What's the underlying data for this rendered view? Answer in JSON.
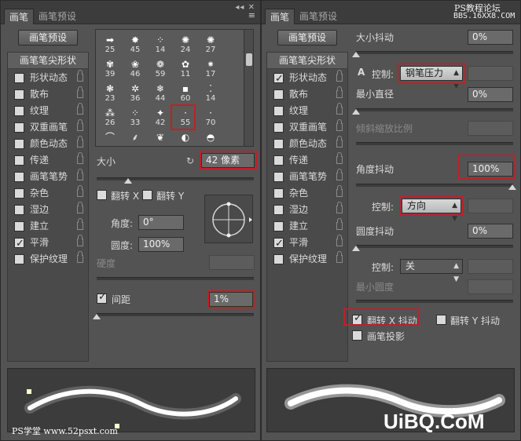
{
  "left": {
    "tabs": [
      "画笔",
      "画笔预设"
    ],
    "panel_controls": "◂◂ ✕",
    "menu_icon": "≡",
    "preset_button": "画笔预设",
    "list_header": "画笔笔尖形状",
    "list_items": [
      {
        "label": "形状动态",
        "checked": false
      },
      {
        "label": "散布",
        "checked": false
      },
      {
        "label": "纹理",
        "checked": false
      },
      {
        "label": "双重画笔",
        "checked": false
      },
      {
        "label": "颜色动态",
        "checked": false
      },
      {
        "label": "传递",
        "checked": false
      },
      {
        "label": "画笔笔势",
        "checked": false
      },
      {
        "label": "杂色",
        "checked": false
      },
      {
        "label": "湿边",
        "checked": false
      },
      {
        "label": "建立",
        "checked": false
      },
      {
        "label": "平滑",
        "checked": true
      },
      {
        "label": "保护纹理",
        "checked": false
      }
    ],
    "brush_grid": [
      {
        "num": "25",
        "sym": "➡"
      },
      {
        "num": "45",
        "sym": "✸"
      },
      {
        "num": "14",
        "sym": "⁘"
      },
      {
        "num": "24",
        "sym": "✺"
      },
      {
        "num": "27",
        "sym": "✺"
      },
      {
        "num": "",
        "sym": ""
      },
      {
        "num": "39",
        "sym": "✾"
      },
      {
        "num": "46",
        "sym": "❀"
      },
      {
        "num": "59",
        "sym": "❁"
      },
      {
        "num": "11",
        "sym": "✿"
      },
      {
        "num": "17",
        "sym": "⁕"
      },
      {
        "num": "",
        "sym": ""
      },
      {
        "num": "23",
        "sym": "❃"
      },
      {
        "num": "36",
        "sym": "✲"
      },
      {
        "num": "44",
        "sym": "❄"
      },
      {
        "num": "60",
        "sym": "▪"
      },
      {
        "num": "14",
        "sym": "⁚"
      },
      {
        "num": "",
        "sym": ""
      },
      {
        "num": "26",
        "sym": "⁂"
      },
      {
        "num": "33",
        "sym": "⁘"
      },
      {
        "num": "42",
        "sym": "✦"
      },
      {
        "num": "55",
        "sym": "·"
      },
      {
        "num": "70",
        "sym": "·"
      },
      {
        "num": "",
        "sym": ""
      },
      {
        "num": "",
        "sym": "⌒"
      },
      {
        "num": "",
        "sym": "⸙"
      },
      {
        "num": "",
        "sym": "❦"
      },
      {
        "num": "",
        "sym": "◐"
      },
      {
        "num": "",
        "sym": "◓"
      },
      {
        "num": "",
        "sym": ""
      }
    ],
    "size_label": "大小",
    "size_value": "42 像素",
    "reset_icon": "↻",
    "flip_x": "翻转 X",
    "flip_y": "翻转 Y",
    "angle_label": "角度:",
    "angle_value": "0°",
    "roundness_label": "圆度:",
    "roundness_value": "100%",
    "hardness_label": "硬度",
    "spacing_label": "间距",
    "spacing_value": "1%",
    "spacing_checked": true,
    "watermark_bottom": "PS学堂 www.52psxt.com"
  },
  "right": {
    "tabs": [
      "画笔",
      "画笔预设"
    ],
    "watermark_top1": "PS教程论坛",
    "watermark_top2": "BBS.16XX8.COM",
    "preset_button": "画笔预设",
    "list_header": "画笔笔尖形状",
    "list_items": [
      {
        "label": "形状动态",
        "checked": true
      },
      {
        "label": "散布",
        "checked": false
      },
      {
        "label": "纹理",
        "checked": false
      },
      {
        "label": "双重画笔",
        "checked": false
      },
      {
        "label": "颜色动态",
        "checked": false
      },
      {
        "label": "传递",
        "checked": false
      },
      {
        "label": "画笔笔势",
        "checked": false
      },
      {
        "label": "杂色",
        "checked": false
      },
      {
        "label": "湿边",
        "checked": false
      },
      {
        "label": "建立",
        "checked": false
      },
      {
        "label": "平滑",
        "checked": true
      },
      {
        "label": "保护纹理",
        "checked": false
      }
    ],
    "size_jitter_label": "大小抖动",
    "size_jitter_value": "0%",
    "warning_icon": "A",
    "control_label": "控制:",
    "control1_value": "钢笔压力",
    "min_diameter_label": "最小直径",
    "min_diameter_value": "0%",
    "tilt_scale_label": "倾斜缩放比例",
    "angle_jitter_label": "角度抖动",
    "angle_jitter_value": "100%",
    "control2_value": "方向",
    "roundness_jitter_label": "圆度抖动",
    "roundness_jitter_value": "0%",
    "control3_value": "关",
    "min_roundness_label": "最小圆度",
    "flip_x_jitter": "翻转 X 抖动",
    "flip_x_checked": true,
    "flip_y_jitter": "翻转 Y 抖动",
    "flip_y_checked": false,
    "brush_projection": "画笔投影",
    "brush_projection_checked": false,
    "watermark_bottom": "UiBQ.CoM"
  },
  "colors": {
    "panel_bg": "#535353",
    "highlight_red": "#c0202a",
    "stroke": "#ffffff"
  }
}
